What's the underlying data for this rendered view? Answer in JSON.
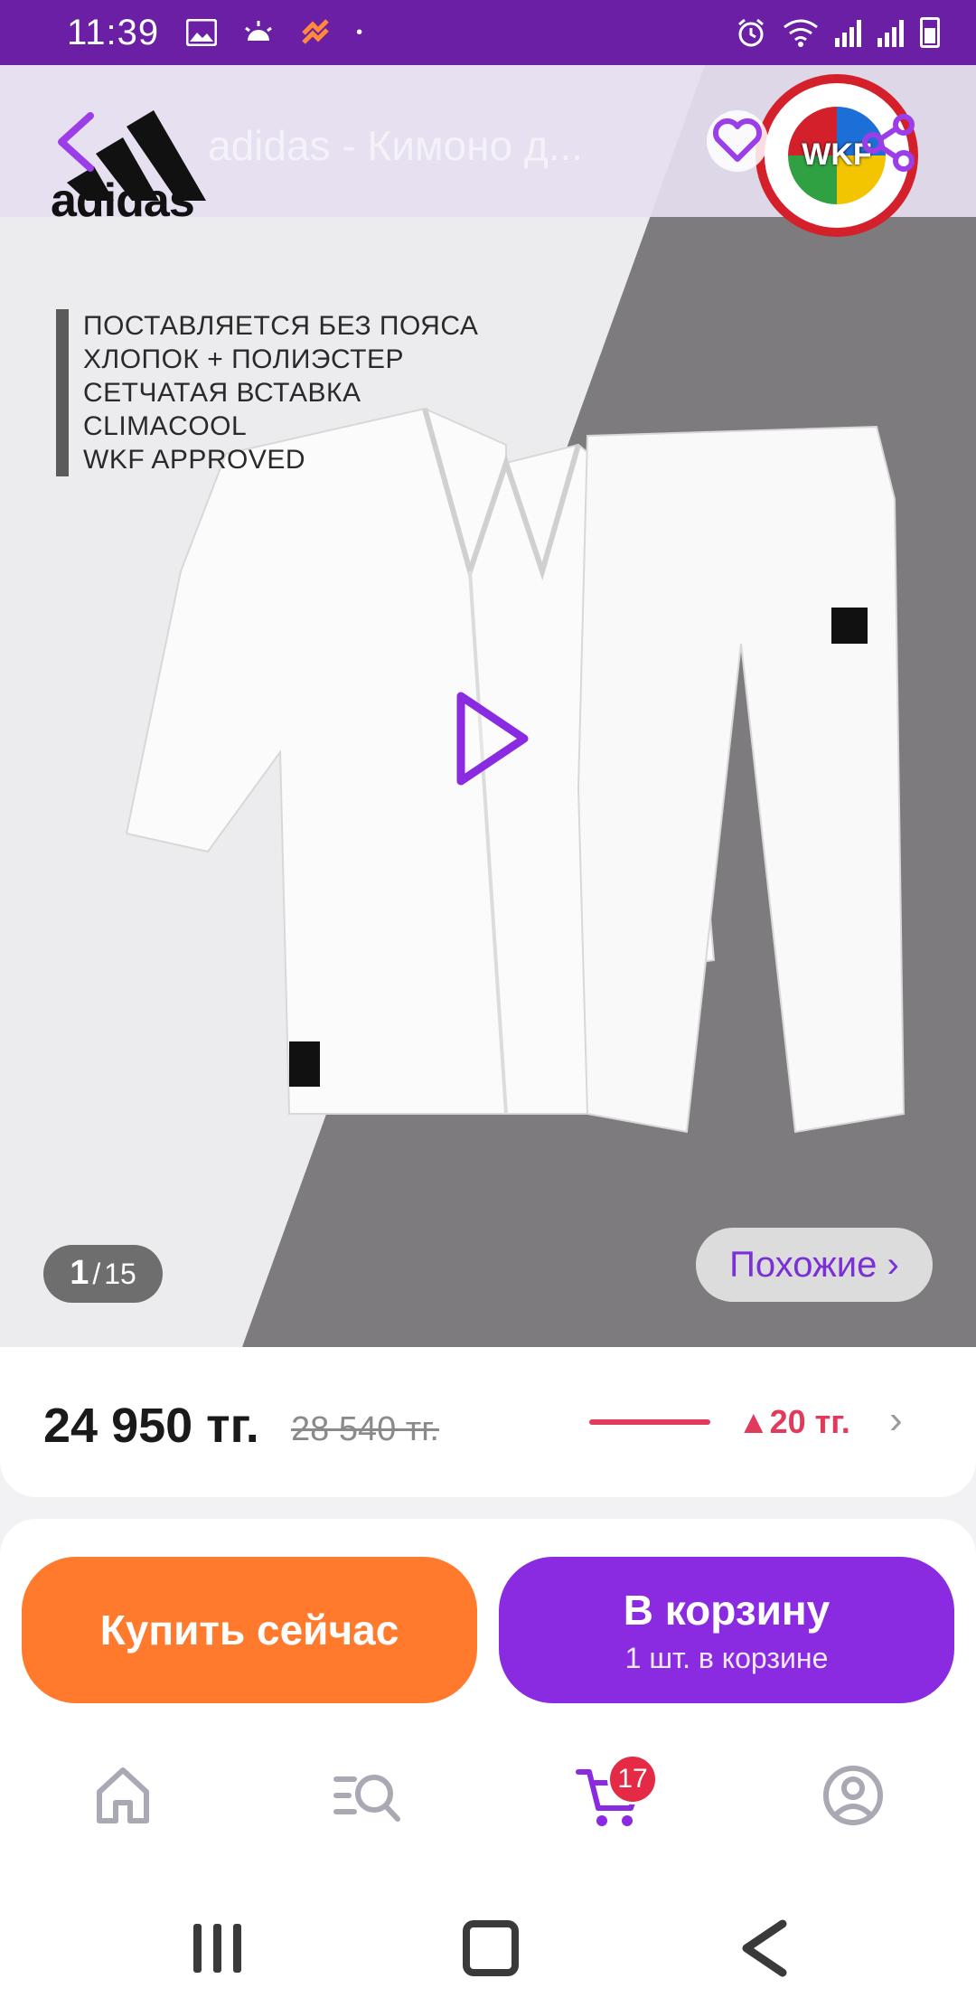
{
  "status_bar": {
    "time": "11:39",
    "battery_level": "7"
  },
  "topbar": {
    "title": "adidas - Кимоно д..."
  },
  "brand_logo": {
    "text": "adidas"
  },
  "wkf_logo": {
    "text": "WKF"
  },
  "features": [
    "ПОСТАВЛЯЕТСЯ БЕЗ ПОЯСА",
    "ХЛОПОК + ПОЛИЭСТЕР",
    "СЕТЧАТАЯ ВСТАВКА",
    "CLIMACOOL",
    "WKF APPROVED"
  ],
  "gallery": {
    "current": "1",
    "separator": "/",
    "total": "15",
    "similar_label": "Похожие ›"
  },
  "price": {
    "current": "24 950 тг.",
    "old": "28 540 тг.",
    "change": "▲20 тг."
  },
  "actions": {
    "buy_label": "Купить сейчас",
    "cart_label": "В корзину",
    "cart_sub": "1 шт. в корзине"
  },
  "bottom_nav": {
    "cart_badge": "17"
  },
  "colors": {
    "brand": "#6a1fa4",
    "accent_purple": "#8a2be2",
    "accent_orange": "#ff7a2d",
    "price_up": "#e23a5a"
  }
}
